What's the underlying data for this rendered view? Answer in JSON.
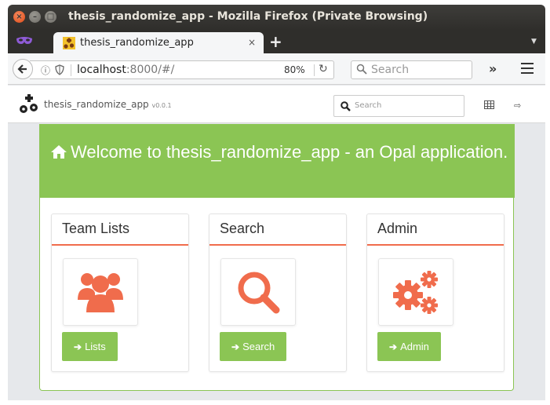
{
  "window": {
    "title": "thesis_randomize_app - Mozilla Firefox (Private Browsing)"
  },
  "tabs": [
    {
      "label": "thesis_randomize_app",
      "close": "×"
    }
  ],
  "new_tab": "+",
  "navbar": {
    "url_host": "localhost",
    "url_rest": ":8000/#/",
    "zoom": "80%",
    "search_placeholder": "Search",
    "overflow": "»"
  },
  "app": {
    "name": "thesis_randomize_app",
    "version": "v0.0.1",
    "search_placeholder": "Search"
  },
  "welcome": {
    "text": "Welcome to thesis_randomize_app - an Opal application."
  },
  "cards": [
    {
      "title": "Team Lists",
      "icon": "users-icon",
      "button": "Lists"
    },
    {
      "title": "Search",
      "icon": "search-icon",
      "button": "Search"
    },
    {
      "title": "Admin",
      "icon": "cogs-icon",
      "button": "Admin"
    }
  ],
  "colors": {
    "brand_green": "#8bc554",
    "accent_orange": "#f06c4c",
    "titlebar": "#2f2e2b"
  }
}
